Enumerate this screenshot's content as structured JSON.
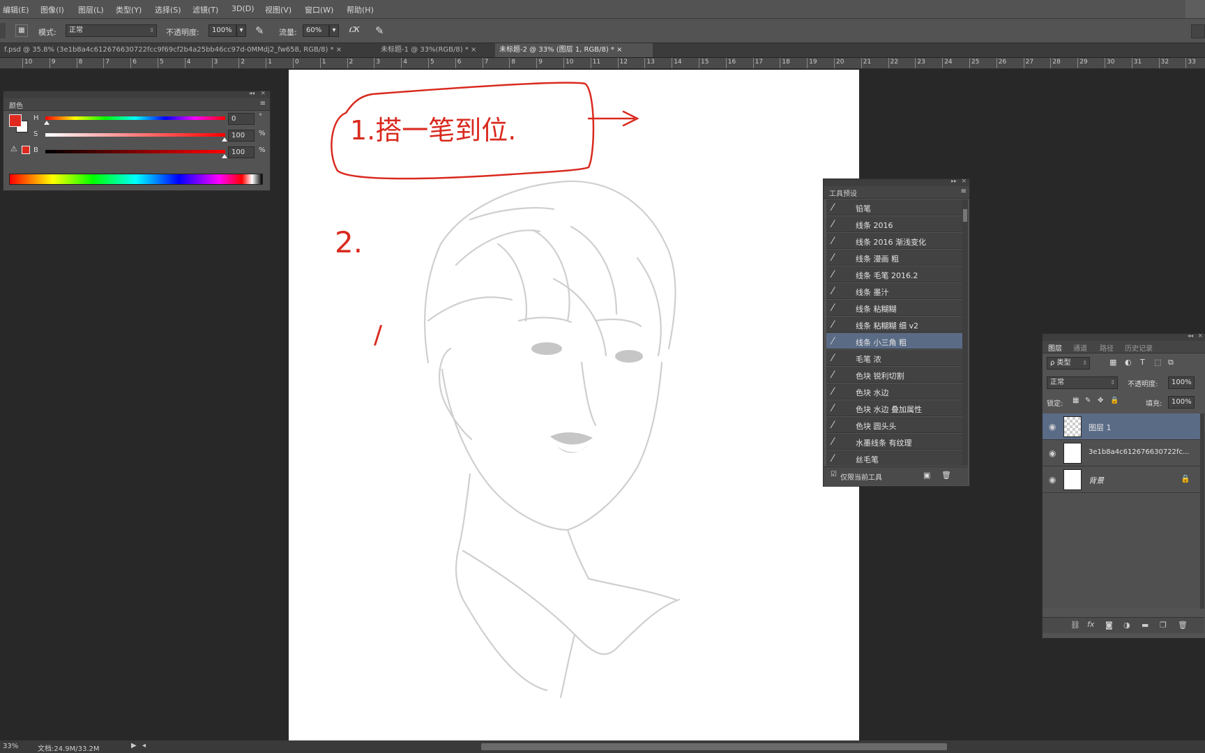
{
  "menu": [
    "编辑(E)",
    "图像(I)",
    "图层(L)",
    "类型(Y)",
    "选择(S)",
    "滤镜(T)",
    "3D(D)",
    "视图(V)",
    "窗口(W)",
    "帮助(H)"
  ],
  "options": {
    "mode_label": "模式:",
    "mode_value": "正常",
    "opacity_label": "不透明度:",
    "opacity_value": "100%",
    "flow_label": "流量:",
    "flow_value": "60%"
  },
  "tabs": [
    "f.psd @ 35.8% (3e1b8a4c6126766307​22fcc9f69cf2b4a25bb46cc97d-0MMdj2_fw658, RGB/8) *",
    "未标题-1 @ 33%(RGB/8) *",
    "未标题-2 @ 33% (图层 1, RGB/8) *"
  ],
  "ruler_top": [
    "10",
    "9",
    "8",
    "7",
    "6",
    "5",
    "4",
    "3",
    "2",
    "1",
    "0",
    "1",
    "2",
    "3",
    "4",
    "5",
    "6",
    "7",
    "8",
    "9",
    "10",
    "11",
    "12",
    "13",
    "14",
    "15",
    "16",
    "17",
    "18",
    "19",
    "20",
    "21",
    "22",
    "23",
    "24",
    "25",
    "26",
    "27",
    "28",
    "29",
    "30",
    "31",
    "32",
    "33"
  ],
  "color_panel": {
    "title": "颜色",
    "h_label": "H",
    "h_value": "0",
    "h_unit": "°",
    "s_label": "S",
    "s_value": "100",
    "s_unit": "%",
    "b_label": "B",
    "b_value": "100",
    "b_unit": "%",
    "foreground": "#e02a20"
  },
  "annotations": {
    "note1": "1.搭一笔到位.",
    "note2": "2.",
    "note3": "/"
  },
  "brush_panel": {
    "title": "工具预设",
    "items": [
      "铅笔",
      "线条 2016",
      "线条 2016 渐浅变化",
      "线条 漫画 粗",
      "线条 毛笔 2016.2",
      "线条 墨汁",
      "线条 粘糊糊",
      "线条 粘糊糊 细 v2",
      "线条 小三角 粗",
      "毛笔 浓",
      "色块 锐利切割",
      "色块 水边",
      "色块 水边 叠加属性",
      "色块 圆头头",
      "水墨线条 有纹理",
      "丝毛笔"
    ],
    "selected_index": 8,
    "footer_label": "仅限当前工具"
  },
  "layers_panel": {
    "tabs": [
      "图层",
      "通道",
      "路径",
      "历史记录"
    ],
    "filter_label": "ρ 类型",
    "blend_mode": "正常",
    "opacity_label": "不透明度:",
    "opacity_value": "100%",
    "lock_label": "锁定:",
    "fill_label": "填充:",
    "fill_value": "100%",
    "layers": [
      {
        "name": "图层 1"
      },
      {
        "name": "3e1b8a4c6126766307​22fc..."
      },
      {
        "name": "背景"
      }
    ],
    "footer_icons": [
      "link-icon",
      "fx-icon",
      "mask-icon",
      "adjustment-icon",
      "folder-icon",
      "new-layer-icon",
      "trash-icon"
    ]
  },
  "status": {
    "zoom": "33%",
    "doc_info": "文档:24.9M/33.2M"
  }
}
